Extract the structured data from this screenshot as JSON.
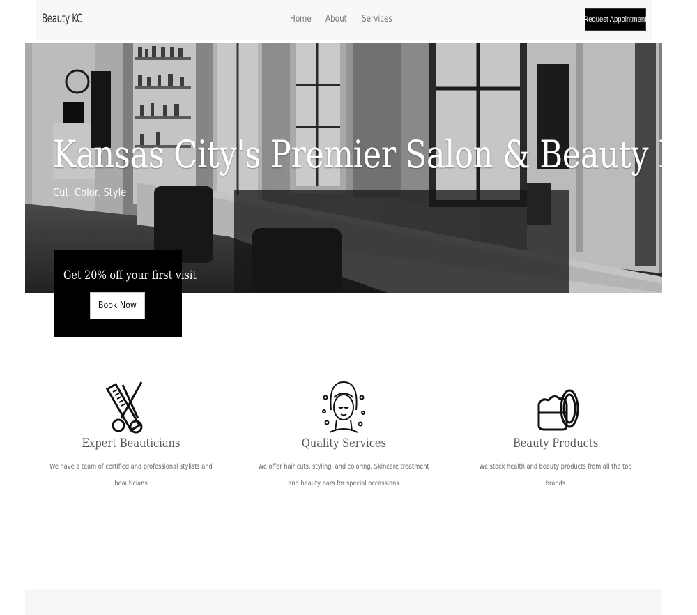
{
  "nav": {
    "brand": "Beauty KC",
    "links": [
      "Home",
      "About",
      "Services"
    ],
    "cta": "Request Appointment"
  },
  "hero": {
    "title": "Kansas City's Premier Salon & Beauty Bar",
    "subtitle": "Cut. Color. Style"
  },
  "promo": {
    "text": "Get 20% off your first visit",
    "button": "Book Now"
  },
  "features": [
    {
      "icon": "scissors-comb-icon",
      "title": "Expert Beauticians",
      "text": "We have a team of certified and professional stylists and beauticians"
    },
    {
      "icon": "woman-face-icon",
      "title": "Quality Services",
      "text": "We offer hair cuts, styling, and coloring. Skincare treatment and beauty bars for special occassions"
    },
    {
      "icon": "cream-jar-icon",
      "title": "Beauty Products",
      "text": "We stock health and beauty products from all the top brands"
    }
  ]
}
